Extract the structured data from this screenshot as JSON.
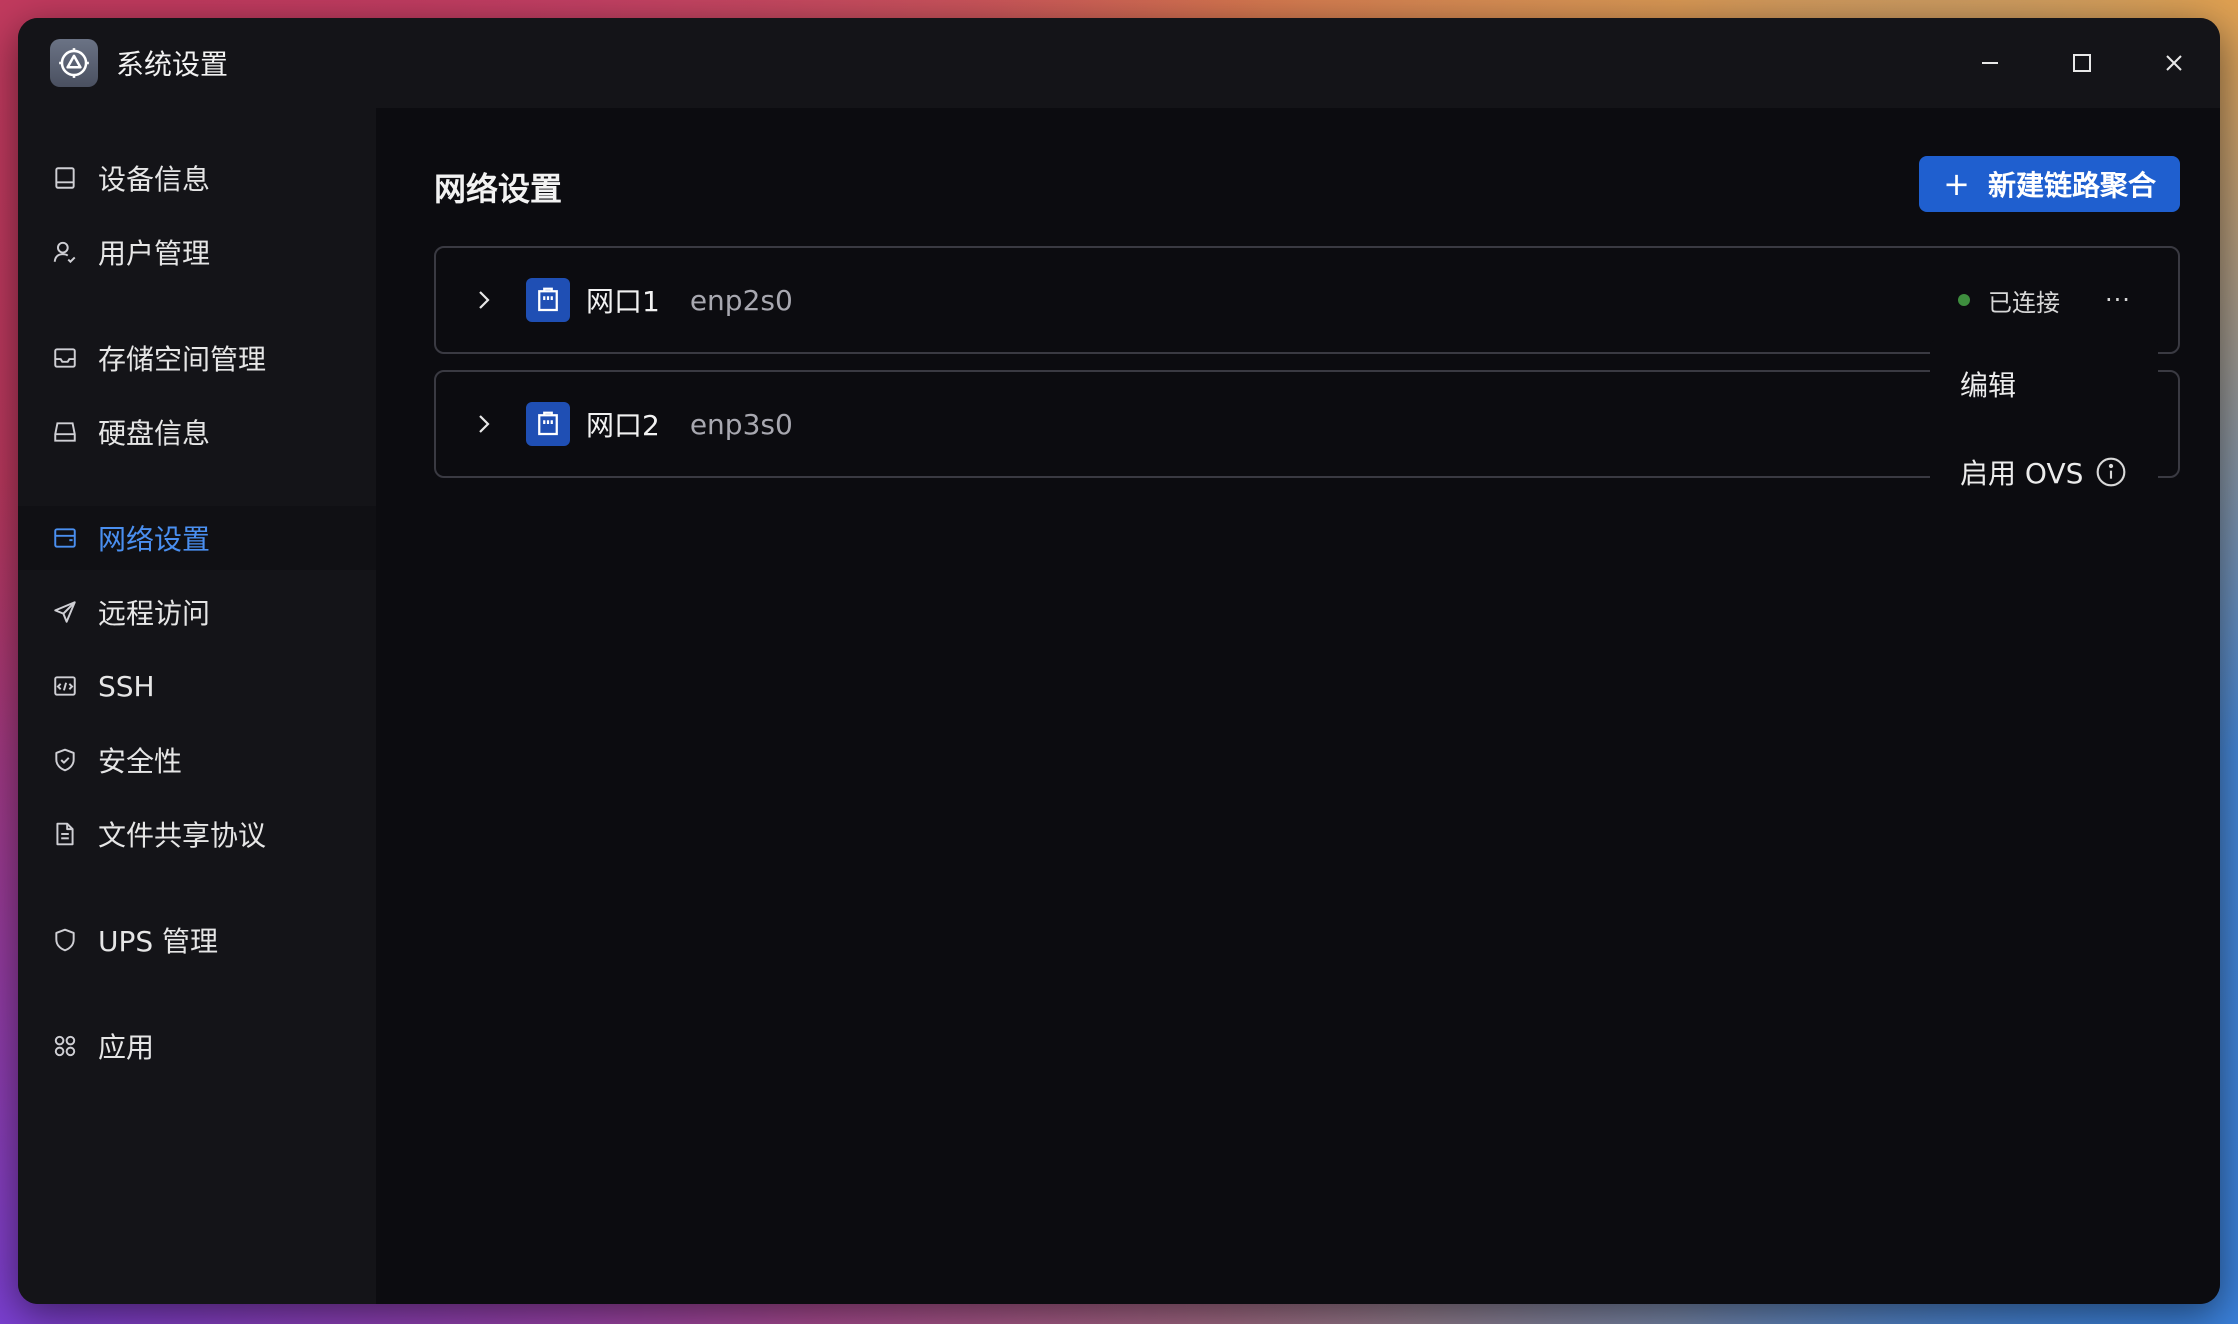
{
  "window": {
    "title": "系统设置",
    "app_icon": "settings-gear-icon",
    "controls": [
      "minimize-icon",
      "maximize-icon",
      "close-icon"
    ]
  },
  "sidebar": {
    "items": [
      {
        "label": "设备信息",
        "icon": "device-icon",
        "active": false
      },
      {
        "label": "用户管理",
        "icon": "user-icon",
        "active": false
      },
      {
        "label": "存储空间管理",
        "icon": "storage-icon",
        "active": false
      },
      {
        "label": "硬盘信息",
        "icon": "disk-icon",
        "active": false
      },
      {
        "label": "网络设置",
        "icon": "network-icon",
        "active": true
      },
      {
        "label": "远程访问",
        "icon": "send-icon",
        "active": false
      },
      {
        "label": "SSH",
        "icon": "terminal-icon",
        "active": false
      },
      {
        "label": "安全性",
        "icon": "shield-check-icon",
        "active": false
      },
      {
        "label": "文件共享协议",
        "icon": "file-icon",
        "active": false
      },
      {
        "label": "UPS 管理",
        "icon": "shield-icon",
        "active": false
      },
      {
        "label": "应用",
        "icon": "apps-icon",
        "active": false
      }
    ]
  },
  "main": {
    "title": "网络设置",
    "new_button_label": "新建链路聚合",
    "ports": [
      {
        "name": "网口1",
        "device": "enp2s0",
        "status": "已连接"
      },
      {
        "name": "网口2",
        "device": "enp3s0",
        "status": ""
      }
    ],
    "more_label": "···",
    "context_menu": {
      "items": [
        {
          "label": "编辑"
        },
        {
          "label": "启用 OVS"
        }
      ]
    }
  },
  "colors": {
    "accent": "#1f5fcf",
    "active_text": "#4a8ff0",
    "status_connected": "#3e8e3e",
    "background": "#0c0c10",
    "sidebar": "#141418"
  }
}
